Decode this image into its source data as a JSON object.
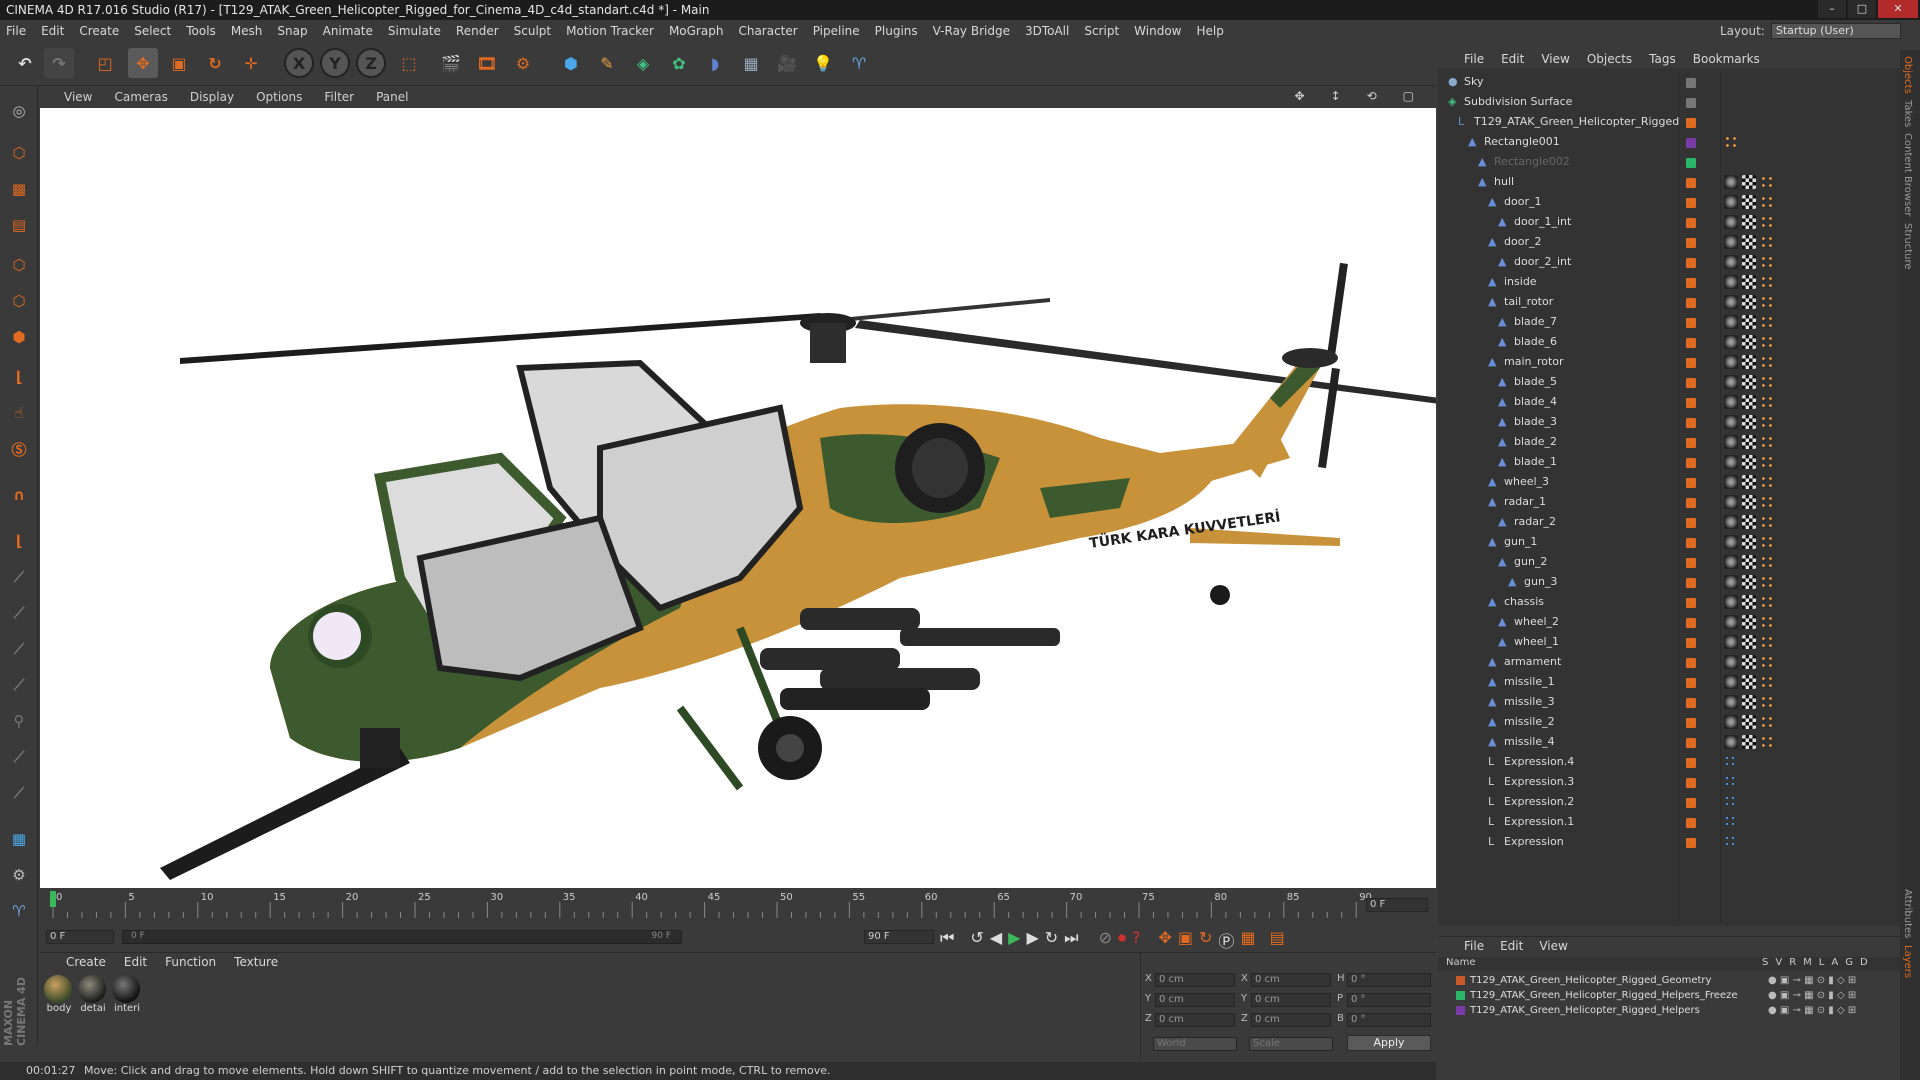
{
  "window": {
    "title": "CINEMA 4D R17.016 Studio (R17) - [T129_ATAK_Green_Helicopter_Rigged_for_Cinema_4D_c4d_standart.c4d *] - Main",
    "minimize": "–",
    "maximize": "□",
    "close": "✕"
  },
  "menubar": [
    "File",
    "Edit",
    "Create",
    "Select",
    "Tools",
    "Mesh",
    "Snap",
    "Animate",
    "Simulate",
    "Render",
    "Sculpt",
    "Motion Tracker",
    "MoGraph",
    "Character",
    "Pipeline",
    "Plugins",
    "V-Ray Bridge",
    "3DToAll",
    "Script",
    "Window",
    "Help"
  ],
  "layout": {
    "label": "Layout:",
    "value": "Startup (User)"
  },
  "toolbar": {
    "undo_icon": "↶",
    "x_label": "X",
    "y_label": "Y",
    "z_label": "Z"
  },
  "viewport": {
    "menu": [
      "View",
      "Cameras",
      "Display",
      "Options",
      "Filter",
      "Panel"
    ],
    "heli_text": "TÜRK KARA KUVVETLERİ"
  },
  "timeline": {
    "ticks": [
      "0",
      "5",
      "10",
      "15",
      "20",
      "25",
      "30",
      "35",
      "40",
      "45",
      "50",
      "55",
      "60",
      "65",
      "70",
      "75",
      "80",
      "85",
      "90"
    ],
    "current_frame_field": "0 F",
    "start_field": "0 F",
    "range_start": "0 F",
    "range_end": "90 F",
    "end_field": "90 F"
  },
  "materials": {
    "menu": [
      "Create",
      "Edit",
      "Function",
      "Texture"
    ],
    "items": [
      "body",
      "detai",
      "interi"
    ]
  },
  "coords": {
    "rows": [
      {
        "a": "X",
        "av": "0 cm",
        "b": "X",
        "bv": "0 cm",
        "c": "H",
        "cv": "0 °"
      },
      {
        "a": "Y",
        "av": "0 cm",
        "b": "Y",
        "bv": "0 cm",
        "c": "P",
        "cv": "0 °"
      },
      {
        "a": "Z",
        "av": "0 cm",
        "b": "Z",
        "bv": "0 cm",
        "c": "B",
        "cv": "0 °"
      }
    ],
    "world": "World",
    "scale": "Scale",
    "apply": "Apply"
  },
  "status": {
    "time": "00:01:27",
    "message": "Move: Click and drag to move elements. Hold down SHIFT to quantize movement / add to the selection in point mode, CTRL to remove."
  },
  "objects": {
    "menu": [
      "File",
      "Edit",
      "View",
      "Objects",
      "Tags",
      "Bookmarks"
    ],
    "rows": [
      {
        "name": "Sky",
        "depth": 0,
        "type": "sky"
      },
      {
        "name": "Subdivision Surface",
        "depth": 0,
        "type": "subd"
      },
      {
        "name": "T129_ATAK_Green_Helicopter_Rigged",
        "depth": 1,
        "type": "null"
      },
      {
        "name": "Rectangle001",
        "depth": 2,
        "type": "bone"
      },
      {
        "name": "Rectangle002",
        "depth": 3,
        "type": "bone"
      },
      {
        "name": "hull",
        "depth": 3,
        "type": "bone"
      },
      {
        "name": "door_1",
        "depth": 4,
        "type": "bone"
      },
      {
        "name": "door_1_int",
        "depth": 5,
        "type": "bone"
      },
      {
        "name": "door_2",
        "depth": 4,
        "type": "bone"
      },
      {
        "name": "door_2_int",
        "depth": 5,
        "type": "bone"
      },
      {
        "name": "inside",
        "depth": 4,
        "type": "bone"
      },
      {
        "name": "tail_rotor",
        "depth": 4,
        "type": "bone"
      },
      {
        "name": "blade_7",
        "depth": 5,
        "type": "bone"
      },
      {
        "name": "blade_6",
        "depth": 5,
        "type": "bone"
      },
      {
        "name": "main_rotor",
        "depth": 4,
        "type": "bone"
      },
      {
        "name": "blade_5",
        "depth": 5,
        "type": "bone"
      },
      {
        "name": "blade_4",
        "depth": 5,
        "type": "bone"
      },
      {
        "name": "blade_3",
        "depth": 5,
        "type": "bone"
      },
      {
        "name": "blade_2",
        "depth": 5,
        "type": "bone"
      },
      {
        "name": "blade_1",
        "depth": 5,
        "type": "bone"
      },
      {
        "name": "wheel_3",
        "depth": 4,
        "type": "bone"
      },
      {
        "name": "radar_1",
        "depth": 4,
        "type": "bone"
      },
      {
        "name": "radar_2",
        "depth": 5,
        "type": "bone"
      },
      {
        "name": "gun_1",
        "depth": 4,
        "type": "bone"
      },
      {
        "name": "gun_2",
        "depth": 5,
        "type": "bone"
      },
      {
        "name": "gun_3",
        "depth": 6,
        "type": "bone"
      },
      {
        "name": "chassis",
        "depth": 4,
        "type": "bone"
      },
      {
        "name": "wheel_2",
        "depth": 5,
        "type": "bone"
      },
      {
        "name": "wheel_1",
        "depth": 5,
        "type": "bone"
      },
      {
        "name": "armament",
        "depth": 4,
        "type": "bone"
      },
      {
        "name": "missile_1",
        "depth": 4,
        "type": "bone"
      },
      {
        "name": "missile_3",
        "depth": 4,
        "type": "bone"
      },
      {
        "name": "missile_2",
        "depth": 4,
        "type": "bone"
      },
      {
        "name": "missile_4",
        "depth": 4,
        "type": "bone"
      },
      {
        "name": "Expression.4",
        "depth": 4,
        "type": "expr"
      },
      {
        "name": "Expression.3",
        "depth": 4,
        "type": "expr"
      },
      {
        "name": "Expression.2",
        "depth": 4,
        "type": "expr"
      },
      {
        "name": "Expression.1",
        "depth": 4,
        "type": "expr"
      },
      {
        "name": "Expression",
        "depth": 4,
        "type": "expr"
      }
    ]
  },
  "layers": {
    "menu": [
      "File",
      "Edit",
      "View"
    ],
    "header_name": "Name",
    "header_cols": [
      "S",
      "V",
      "R",
      "M",
      "L",
      "A",
      "G",
      "D"
    ],
    "rows": [
      {
        "name": "T129_ATAK_Green_Helicopter_Rigged_Geometry",
        "color": "#c85a2a"
      },
      {
        "name": "T129_ATAK_Green_Helicopter_Rigged_Helpers_Freeze",
        "color": "#2bb56a"
      },
      {
        "name": "T129_ATAK_Green_Helicopter_Rigged_Helpers",
        "color": "#7a3aa8"
      }
    ]
  },
  "sidetabs": [
    "Objects",
    "Takes",
    "Content Browser",
    "Structure",
    "Attributes",
    "Layers"
  ],
  "colors": {
    "accent": "#e06a1f",
    "select_blue": "#4a8fd8",
    "bg": "#3a3a3a"
  }
}
